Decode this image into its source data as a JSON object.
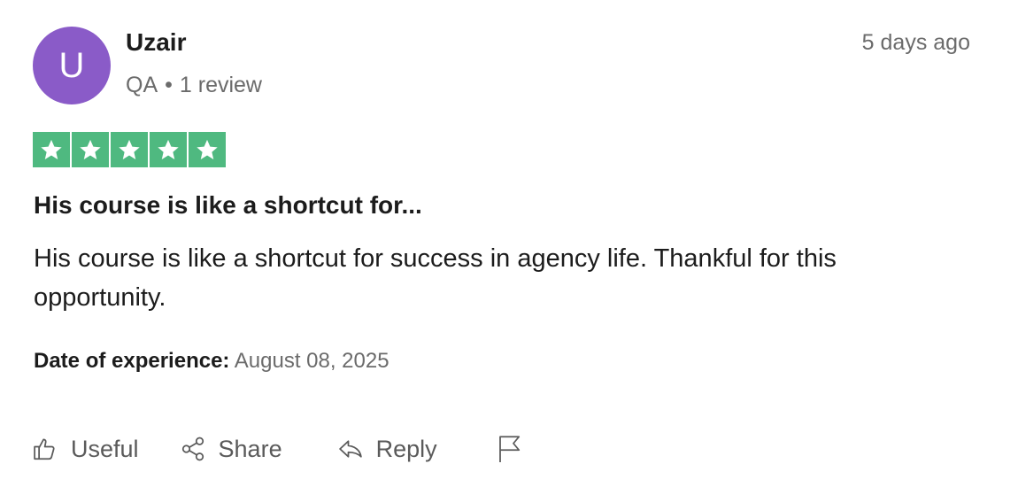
{
  "review": {
    "avatar_initial": "U",
    "reviewer_name": "Uzair",
    "country": "QA",
    "separator": "•",
    "review_count": "1 review",
    "posted_ago": "5 days ago",
    "rating": 5,
    "rating_max": 5,
    "title": "His course is like a shortcut for...",
    "body": "His course is like a shortcut for success in agency life. Thankful for this opportunity.",
    "experience_label": "Date of experience:",
    "experience_date": "August 08, 2025"
  },
  "actions": {
    "useful_label": "Useful",
    "share_label": "Share",
    "reply_label": "Reply"
  },
  "colors": {
    "avatar_bg": "#8a5bc8",
    "star_bg": "#4fb980",
    "text_primary": "#1c1c1c",
    "text_secondary": "#6b6b6b"
  },
  "icons": {
    "useful": "thumbs-up-icon",
    "share": "share-icon",
    "reply": "reply-icon",
    "report": "flag-icon"
  }
}
